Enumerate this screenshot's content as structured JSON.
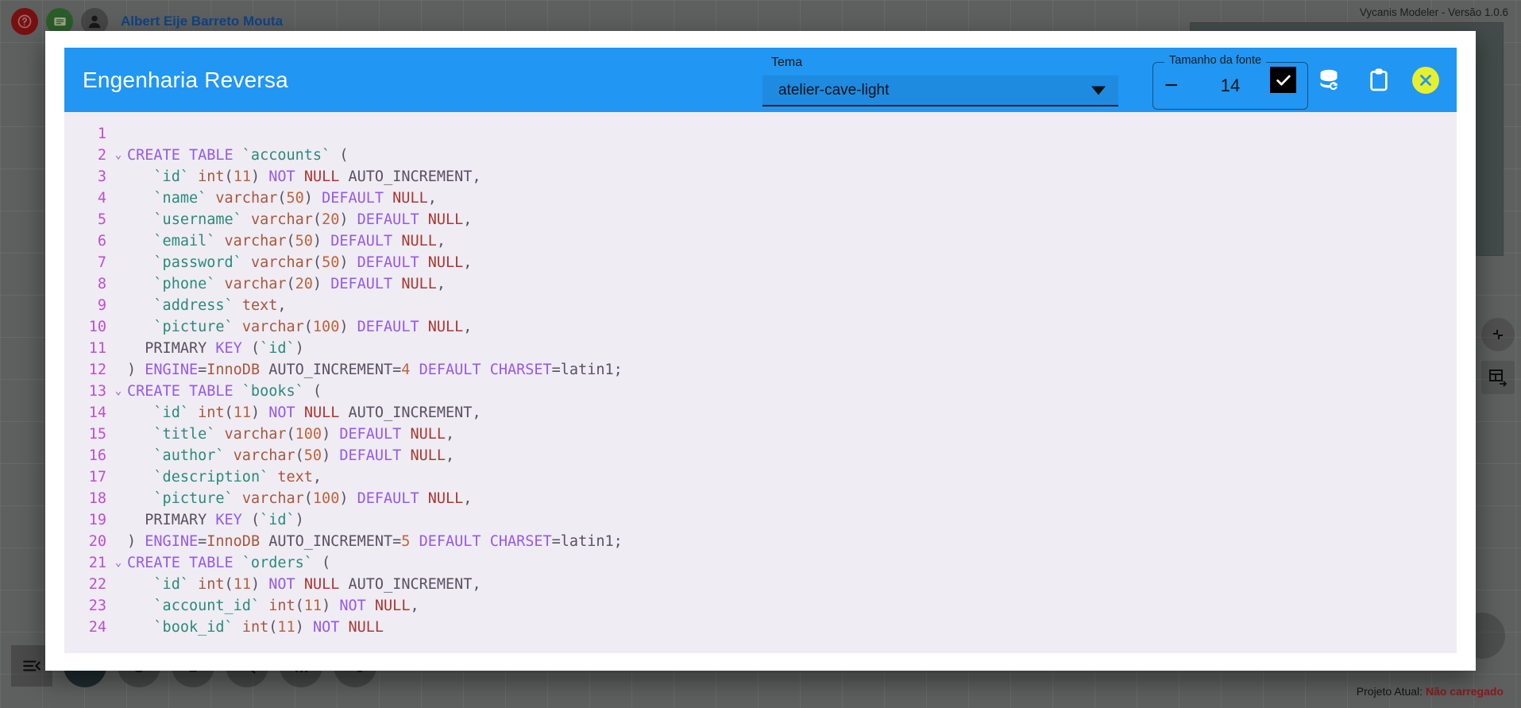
{
  "app": {
    "version_label": "Vycanis Modeler - Versão 1.0.6",
    "user_name": "Albert Eije Barreto Mouta",
    "icons": {
      "help": "help-icon",
      "message": "message-icon",
      "user": "user-avatar-icon",
      "collapse": "collapse-arrows-icon",
      "table_export": "table-export-icon",
      "dock_collapse": "dock-collapse-icon"
    },
    "status": {
      "label": "Projeto Atual:",
      "value": "Não carregado",
      "value_color": "#c62828"
    }
  },
  "modal": {
    "title": "Engenharia Reversa",
    "header_color": "#2196f3",
    "theme": {
      "label": "Tema",
      "value": "atelier-cave-light"
    },
    "font_size": {
      "legend": "Tamanho da fonte",
      "value": "14",
      "decrement": "−",
      "increment": "+"
    },
    "actions": [
      {
        "name": "confirm-checkbox",
        "icon": "checkbox-checked-icon",
        "checked": true
      },
      {
        "name": "database-refresh-button",
        "icon": "database-refresh-icon"
      },
      {
        "name": "copy-clipboard-button",
        "icon": "clipboard-icon"
      },
      {
        "name": "close-button",
        "icon": "close-circle-icon",
        "color": "#e8f02e"
      }
    ]
  },
  "editor": {
    "theme": "atelier-cave-light",
    "background": "#efecf4",
    "line_number_color": "#be4fce",
    "font_size": 14,
    "lines": [
      {
        "n": "1",
        "fold": "",
        "tokens": []
      },
      {
        "n": "2",
        "fold": "⌄",
        "tokens": [
          {
            "t": "CREATE TABLE ",
            "c": "t-kw"
          },
          {
            "t": "`accounts`",
            "c": "t-id"
          },
          {
            "t": " (",
            "c": "t-punc"
          }
        ]
      },
      {
        "n": "3",
        "fold": "",
        "tokens": [
          {
            "t": "   ",
            "c": "t-pl"
          },
          {
            "t": "`id`",
            "c": "t-id"
          },
          {
            "t": " ",
            "c": "t-pl"
          },
          {
            "t": "int",
            "c": "t-type"
          },
          {
            "t": "(",
            "c": "t-punc"
          },
          {
            "t": "11",
            "c": "t-num"
          },
          {
            "t": ") ",
            "c": "t-punc"
          },
          {
            "t": "NOT ",
            "c": "t-mod"
          },
          {
            "t": "NULL",
            "c": "t-null"
          },
          {
            "t": " AUTO_INCREMENT,",
            "c": "t-pl"
          }
        ]
      },
      {
        "n": "4",
        "fold": "",
        "tokens": [
          {
            "t": "   ",
            "c": "t-pl"
          },
          {
            "t": "`name`",
            "c": "t-id"
          },
          {
            "t": " ",
            "c": "t-pl"
          },
          {
            "t": "varchar",
            "c": "t-type"
          },
          {
            "t": "(",
            "c": "t-punc"
          },
          {
            "t": "50",
            "c": "t-num"
          },
          {
            "t": ") ",
            "c": "t-punc"
          },
          {
            "t": "DEFAULT ",
            "c": "t-mod"
          },
          {
            "t": "NULL",
            "c": "t-null"
          },
          {
            "t": ",",
            "c": "t-punc"
          }
        ]
      },
      {
        "n": "5",
        "fold": "",
        "tokens": [
          {
            "t": "   ",
            "c": "t-pl"
          },
          {
            "t": "`username`",
            "c": "t-id"
          },
          {
            "t": " ",
            "c": "t-pl"
          },
          {
            "t": "varchar",
            "c": "t-type"
          },
          {
            "t": "(",
            "c": "t-punc"
          },
          {
            "t": "20",
            "c": "t-num"
          },
          {
            "t": ") ",
            "c": "t-punc"
          },
          {
            "t": "DEFAULT ",
            "c": "t-mod"
          },
          {
            "t": "NULL",
            "c": "t-null"
          },
          {
            "t": ",",
            "c": "t-punc"
          }
        ]
      },
      {
        "n": "6",
        "fold": "",
        "tokens": [
          {
            "t": "   ",
            "c": "t-pl"
          },
          {
            "t": "`email`",
            "c": "t-id"
          },
          {
            "t": " ",
            "c": "t-pl"
          },
          {
            "t": "varchar",
            "c": "t-type"
          },
          {
            "t": "(",
            "c": "t-punc"
          },
          {
            "t": "50",
            "c": "t-num"
          },
          {
            "t": ") ",
            "c": "t-punc"
          },
          {
            "t": "DEFAULT ",
            "c": "t-mod"
          },
          {
            "t": "NULL",
            "c": "t-null"
          },
          {
            "t": ",",
            "c": "t-punc"
          }
        ]
      },
      {
        "n": "7",
        "fold": "",
        "tokens": [
          {
            "t": "   ",
            "c": "t-pl"
          },
          {
            "t": "`password`",
            "c": "t-id"
          },
          {
            "t": " ",
            "c": "t-pl"
          },
          {
            "t": "varchar",
            "c": "t-type"
          },
          {
            "t": "(",
            "c": "t-punc"
          },
          {
            "t": "50",
            "c": "t-num"
          },
          {
            "t": ") ",
            "c": "t-punc"
          },
          {
            "t": "DEFAULT ",
            "c": "t-mod"
          },
          {
            "t": "NULL",
            "c": "t-null"
          },
          {
            "t": ",",
            "c": "t-punc"
          }
        ]
      },
      {
        "n": "8",
        "fold": "",
        "tokens": [
          {
            "t": "   ",
            "c": "t-pl"
          },
          {
            "t": "`phone`",
            "c": "t-id"
          },
          {
            "t": " ",
            "c": "t-pl"
          },
          {
            "t": "varchar",
            "c": "t-type"
          },
          {
            "t": "(",
            "c": "t-punc"
          },
          {
            "t": "20",
            "c": "t-num"
          },
          {
            "t": ") ",
            "c": "t-punc"
          },
          {
            "t": "DEFAULT ",
            "c": "t-mod"
          },
          {
            "t": "NULL",
            "c": "t-null"
          },
          {
            "t": ",",
            "c": "t-punc"
          }
        ]
      },
      {
        "n": "9",
        "fold": "",
        "tokens": [
          {
            "t": "   ",
            "c": "t-pl"
          },
          {
            "t": "`address`",
            "c": "t-id"
          },
          {
            "t": " ",
            "c": "t-pl"
          },
          {
            "t": "text",
            "c": "t-type"
          },
          {
            "t": ",",
            "c": "t-punc"
          }
        ]
      },
      {
        "n": "10",
        "fold": "",
        "tokens": [
          {
            "t": "   ",
            "c": "t-pl"
          },
          {
            "t": "`picture`",
            "c": "t-id"
          },
          {
            "t": " ",
            "c": "t-pl"
          },
          {
            "t": "varchar",
            "c": "t-type"
          },
          {
            "t": "(",
            "c": "t-punc"
          },
          {
            "t": "100",
            "c": "t-num"
          },
          {
            "t": ") ",
            "c": "t-punc"
          },
          {
            "t": "DEFAULT ",
            "c": "t-mod"
          },
          {
            "t": "NULL",
            "c": "t-null"
          },
          {
            "t": ",",
            "c": "t-punc"
          }
        ]
      },
      {
        "n": "11",
        "fold": "",
        "tokens": [
          {
            "t": "  PRIMARY ",
            "c": "t-pl"
          },
          {
            "t": "KEY",
            "c": "t-mod"
          },
          {
            "t": " (",
            "c": "t-punc"
          },
          {
            "t": "`id`",
            "c": "t-id"
          },
          {
            "t": ")",
            "c": "t-punc"
          }
        ]
      },
      {
        "n": "12",
        "fold": "",
        "tokens": [
          {
            "t": ") ",
            "c": "t-punc"
          },
          {
            "t": "ENGINE",
            "c": "t-mod"
          },
          {
            "t": "=",
            "c": "t-punc"
          },
          {
            "t": "InnoDB",
            "c": "t-type"
          },
          {
            "t": " AUTO_INCREMENT=",
            "c": "t-pl"
          },
          {
            "t": "4",
            "c": "t-num"
          },
          {
            "t": " DEFAULT ",
            "c": "t-mod"
          },
          {
            "t": "CHARSET",
            "c": "t-mod"
          },
          {
            "t": "=latin1;",
            "c": "t-pl"
          }
        ]
      },
      {
        "n": "13",
        "fold": "⌄",
        "tokens": [
          {
            "t": "CREATE TABLE ",
            "c": "t-kw"
          },
          {
            "t": "`books`",
            "c": "t-id"
          },
          {
            "t": " (",
            "c": "t-punc"
          }
        ]
      },
      {
        "n": "14",
        "fold": "",
        "tokens": [
          {
            "t": "   ",
            "c": "t-pl"
          },
          {
            "t": "`id`",
            "c": "t-id"
          },
          {
            "t": " ",
            "c": "t-pl"
          },
          {
            "t": "int",
            "c": "t-type"
          },
          {
            "t": "(",
            "c": "t-punc"
          },
          {
            "t": "11",
            "c": "t-num"
          },
          {
            "t": ") ",
            "c": "t-punc"
          },
          {
            "t": "NOT ",
            "c": "t-mod"
          },
          {
            "t": "NULL",
            "c": "t-null"
          },
          {
            "t": " AUTO_INCREMENT,",
            "c": "t-pl"
          }
        ]
      },
      {
        "n": "15",
        "fold": "",
        "tokens": [
          {
            "t": "   ",
            "c": "t-pl"
          },
          {
            "t": "`title`",
            "c": "t-id"
          },
          {
            "t": " ",
            "c": "t-pl"
          },
          {
            "t": "varchar",
            "c": "t-type"
          },
          {
            "t": "(",
            "c": "t-punc"
          },
          {
            "t": "100",
            "c": "t-num"
          },
          {
            "t": ") ",
            "c": "t-punc"
          },
          {
            "t": "DEFAULT ",
            "c": "t-mod"
          },
          {
            "t": "NULL",
            "c": "t-null"
          },
          {
            "t": ",",
            "c": "t-punc"
          }
        ]
      },
      {
        "n": "16",
        "fold": "",
        "tokens": [
          {
            "t": "   ",
            "c": "t-pl"
          },
          {
            "t": "`author`",
            "c": "t-id"
          },
          {
            "t": " ",
            "c": "t-pl"
          },
          {
            "t": "varchar",
            "c": "t-type"
          },
          {
            "t": "(",
            "c": "t-punc"
          },
          {
            "t": "50",
            "c": "t-num"
          },
          {
            "t": ") ",
            "c": "t-punc"
          },
          {
            "t": "DEFAULT ",
            "c": "t-mod"
          },
          {
            "t": "NULL",
            "c": "t-null"
          },
          {
            "t": ",",
            "c": "t-punc"
          }
        ]
      },
      {
        "n": "17",
        "fold": "",
        "tokens": [
          {
            "t": "   ",
            "c": "t-pl"
          },
          {
            "t": "`description`",
            "c": "t-id"
          },
          {
            "t": " ",
            "c": "t-pl"
          },
          {
            "t": "text",
            "c": "t-type"
          },
          {
            "t": ",",
            "c": "t-punc"
          }
        ]
      },
      {
        "n": "18",
        "fold": "",
        "tokens": [
          {
            "t": "   ",
            "c": "t-pl"
          },
          {
            "t": "`picture`",
            "c": "t-id"
          },
          {
            "t": " ",
            "c": "t-pl"
          },
          {
            "t": "varchar",
            "c": "t-type"
          },
          {
            "t": "(",
            "c": "t-punc"
          },
          {
            "t": "100",
            "c": "t-num"
          },
          {
            "t": ") ",
            "c": "t-punc"
          },
          {
            "t": "DEFAULT ",
            "c": "t-mod"
          },
          {
            "t": "NULL",
            "c": "t-null"
          },
          {
            "t": ",",
            "c": "t-punc"
          }
        ]
      },
      {
        "n": "19",
        "fold": "",
        "tokens": [
          {
            "t": "  PRIMARY ",
            "c": "t-pl"
          },
          {
            "t": "KEY",
            "c": "t-mod"
          },
          {
            "t": " (",
            "c": "t-punc"
          },
          {
            "t": "`id`",
            "c": "t-id"
          },
          {
            "t": ")",
            "c": "t-punc"
          }
        ]
      },
      {
        "n": "20",
        "fold": "",
        "tokens": [
          {
            "t": ") ",
            "c": "t-punc"
          },
          {
            "t": "ENGINE",
            "c": "t-mod"
          },
          {
            "t": "=",
            "c": "t-punc"
          },
          {
            "t": "InnoDB",
            "c": "t-type"
          },
          {
            "t": " AUTO_INCREMENT=",
            "c": "t-pl"
          },
          {
            "t": "5",
            "c": "t-num"
          },
          {
            "t": " DEFAULT ",
            "c": "t-mod"
          },
          {
            "t": "CHARSET",
            "c": "t-mod"
          },
          {
            "t": "=latin1;",
            "c": "t-pl"
          }
        ]
      },
      {
        "n": "21",
        "fold": "⌄",
        "tokens": [
          {
            "t": "CREATE TABLE ",
            "c": "t-kw"
          },
          {
            "t": "`orders`",
            "c": "t-id"
          },
          {
            "t": " (",
            "c": "t-punc"
          }
        ]
      },
      {
        "n": "22",
        "fold": "",
        "tokens": [
          {
            "t": "   ",
            "c": "t-pl"
          },
          {
            "t": "`id`",
            "c": "t-id"
          },
          {
            "t": " ",
            "c": "t-pl"
          },
          {
            "t": "int",
            "c": "t-type"
          },
          {
            "t": "(",
            "c": "t-punc"
          },
          {
            "t": "11",
            "c": "t-num"
          },
          {
            "t": ") ",
            "c": "t-punc"
          },
          {
            "t": "NOT ",
            "c": "t-mod"
          },
          {
            "t": "NULL",
            "c": "t-null"
          },
          {
            "t": " AUTO_INCREMENT,",
            "c": "t-pl"
          }
        ]
      },
      {
        "n": "23",
        "fold": "",
        "tokens": [
          {
            "t": "   ",
            "c": "t-pl"
          },
          {
            "t": "`account_id`",
            "c": "t-id"
          },
          {
            "t": " ",
            "c": "t-pl"
          },
          {
            "t": "int",
            "c": "t-type"
          },
          {
            "t": "(",
            "c": "t-punc"
          },
          {
            "t": "11",
            "c": "t-num"
          },
          {
            "t": ") ",
            "c": "t-punc"
          },
          {
            "t": "NOT ",
            "c": "t-mod"
          },
          {
            "t": "NULL",
            "c": "t-null"
          },
          {
            "t": ",",
            "c": "t-punc"
          }
        ]
      },
      {
        "n": "24",
        "fold": "",
        "tokens": [
          {
            "t": "   ",
            "c": "t-pl"
          },
          {
            "t": "`book_id`",
            "c": "t-id"
          },
          {
            "t": " ",
            "c": "t-pl"
          },
          {
            "t": "int",
            "c": "t-type"
          },
          {
            "t": "(",
            "c": "t-punc"
          },
          {
            "t": "11",
            "c": "t-num"
          },
          {
            "t": ") ",
            "c": "t-punc"
          },
          {
            "t": "NOT ",
            "c": "t-mod"
          },
          {
            "t": "NULL",
            "c": "t-null"
          }
        ]
      }
    ]
  }
}
